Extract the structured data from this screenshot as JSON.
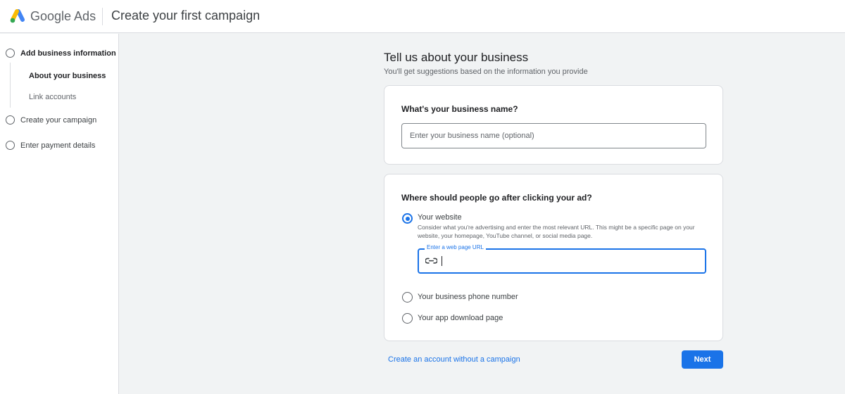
{
  "header": {
    "brand": "Google Ads",
    "title": "Create your first campaign"
  },
  "sidebar": {
    "steps": [
      {
        "label": "Add business information",
        "substeps": [
          "About your business",
          "Link accounts"
        ]
      },
      {
        "label": "Create your campaign"
      },
      {
        "label": "Enter payment details"
      }
    ]
  },
  "main": {
    "heading": "Tell us about your business",
    "subheading": "You'll get suggestions based on the information you provide",
    "business_name": {
      "question": "What's your business name?",
      "placeholder": "Enter your business name (optional)",
      "value": ""
    },
    "destination": {
      "question": "Where should people go after clicking your ad?",
      "selected": "Your website",
      "options": [
        {
          "label": "Your website",
          "description": "Consider what you're advertising and enter the most relevant URL. This might be a specific page on your website, your homepage, YouTube channel, or social media page."
        },
        {
          "label": "Your business phone number"
        },
        {
          "label": "Your app download page"
        }
      ],
      "url_label": "Enter a web page URL",
      "url_value": ""
    },
    "alt_link": "Create an account without a campaign",
    "next": "Next"
  },
  "colors": {
    "accent": "#1a73e8",
    "background": "#f1f3f4"
  },
  "icons": [
    "google-ads-logo",
    "link-icon"
  ]
}
